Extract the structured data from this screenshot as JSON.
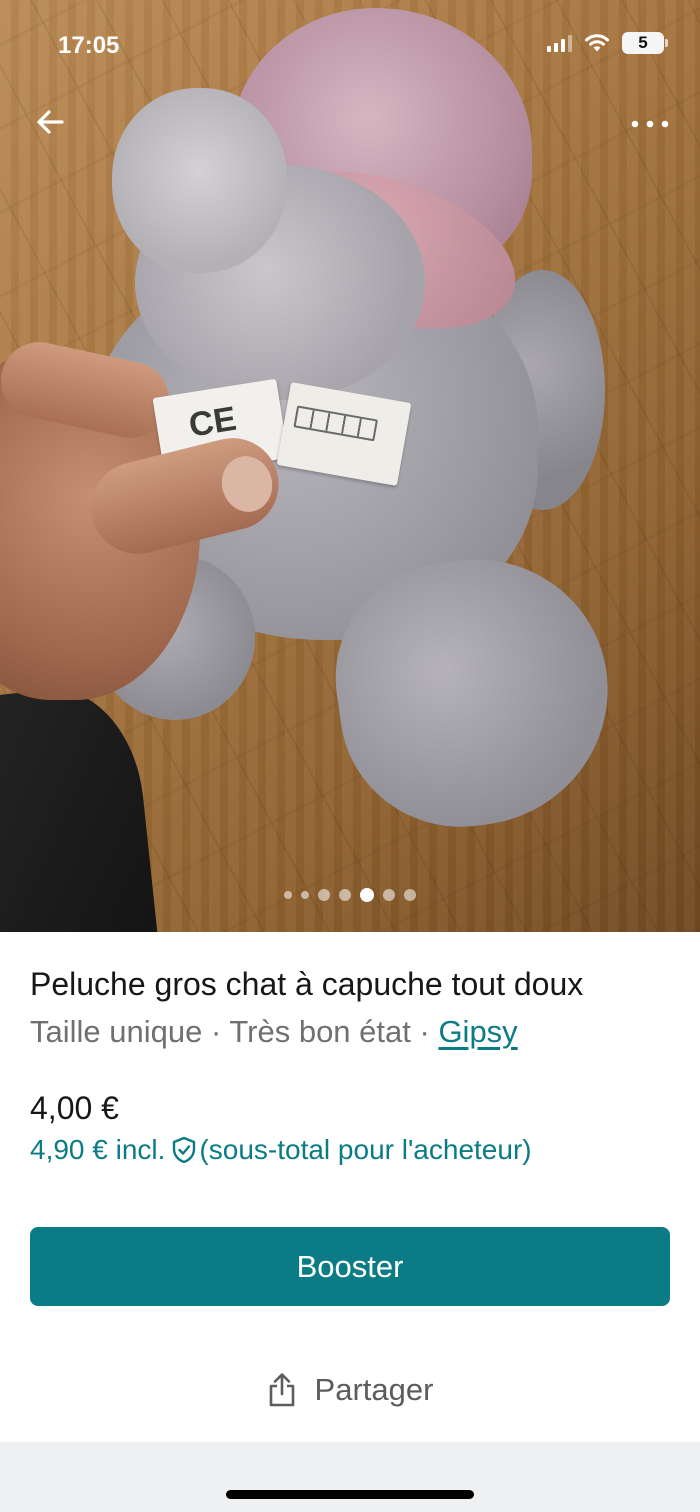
{
  "status_bar": {
    "time": "17:05",
    "battery": "5",
    "icons": [
      "cellular-signal-icon",
      "wifi-icon",
      "battery-icon"
    ]
  },
  "photo": {
    "total_images": 7,
    "active_index": 4
  },
  "nav": {
    "icons": [
      "back-arrow-icon",
      "more-options-icon"
    ]
  },
  "item": {
    "title": "Peluche gros chat à capuche tout doux",
    "size": "Taille unique",
    "condition": "Très bon état",
    "separator": " · ",
    "brand": "Gipsy",
    "price": "4,00 €",
    "price_incl_prefix": "4,90 € incl.",
    "price_incl_suffix": "(sous-total pour l'acheteur)"
  },
  "actions": {
    "booster_label": "Booster",
    "share_label": "Partager"
  },
  "colors": {
    "accent": "#0b7c85",
    "secondary_text": "#707070",
    "bottom_band": "#eff0f1"
  }
}
